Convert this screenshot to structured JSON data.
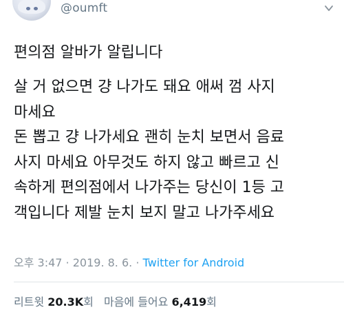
{
  "header": {
    "handle": "@oumft",
    "avatar_icon": "anime-avatar-icon",
    "menu_icon": "chevron-down-icon"
  },
  "tweet": {
    "title": "편의점 알바가 알립니다",
    "lines": [
      "살 거 없으면 걍 나가도 돼요 애써 껌 사지",
      "마세요",
      "돈 뽑고 걍 나가세요 괜히 눈치 보면서 음료",
      "사지 마세요 아무것도 하지 않고 빠르고 신",
      "속하게 편의점에서 나가주는 당신이 1등 고",
      "객입니다 제발 눈치 보지 말고 나가주세요"
    ]
  },
  "meta": {
    "time": "오후 3:47",
    "separator1": " · ",
    "date": "2019. 8. 6.",
    "separator2": " · ",
    "source": "Twitter for Android"
  },
  "stats": {
    "retweets_label": "리트윗",
    "retweets_value": "20.3K",
    "retweets_unit": "회",
    "likes_label": "마음에 들어요",
    "likes_value": "6,419",
    "likes_unit": "회"
  },
  "colors": {
    "text": "#14171a",
    "muted": "#8a949d",
    "link": "#1da1f2",
    "divider": "#dfe3e7"
  }
}
